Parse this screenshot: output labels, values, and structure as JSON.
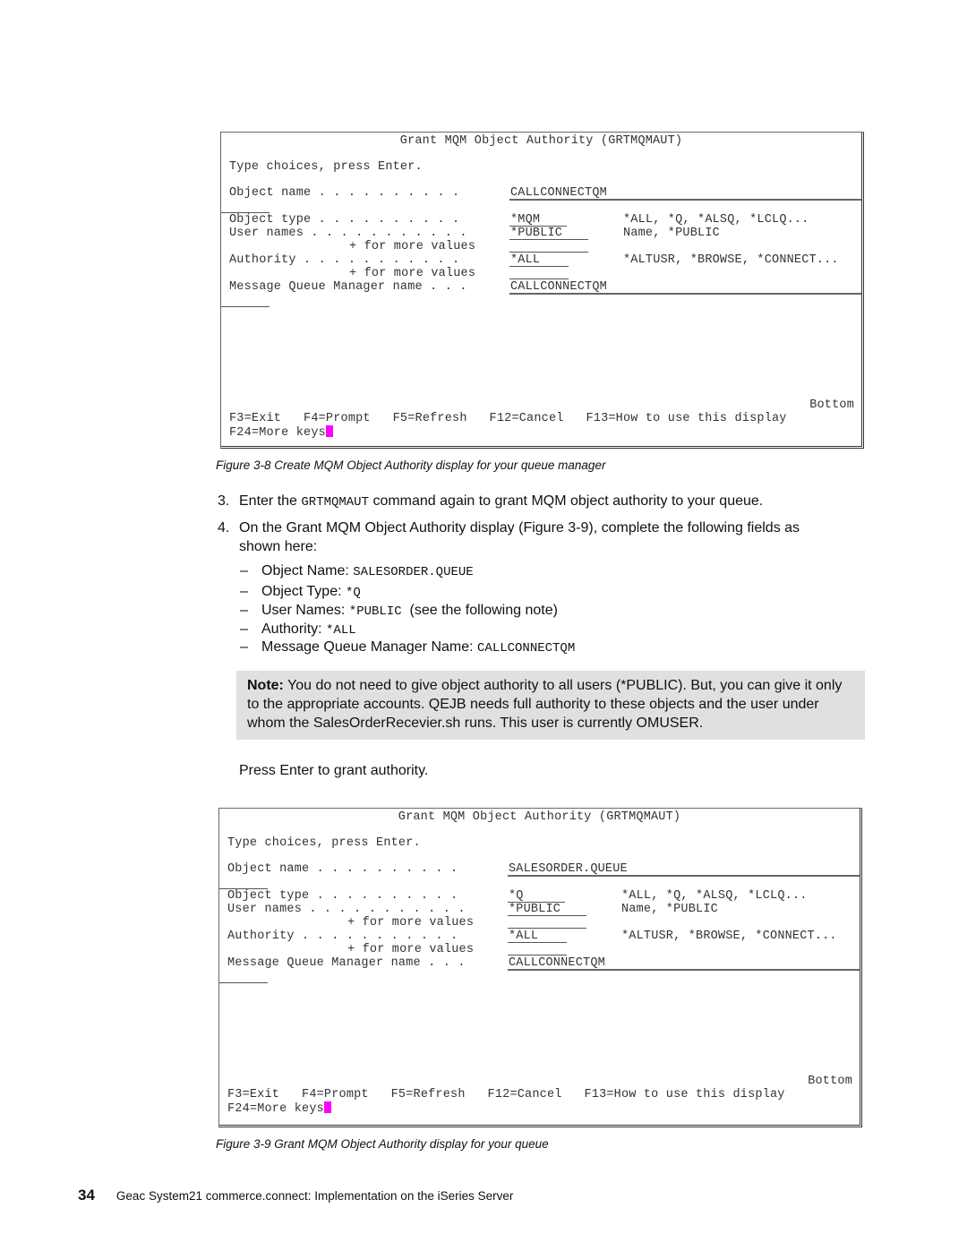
{
  "figure_3_8": {
    "screen": {
      "title": "Grant MQM Object Authority (GRTMQMAUT)",
      "instruction": "Type choices, press Enter.",
      "fields": {
        "object_name": {
          "label": "Object name . . . . . . . . . .",
          "value": "CALLCONNECTQM"
        },
        "object_type": {
          "label": "Object type . . . . . . . . . .",
          "value": "*MQM",
          "hint": "*ALL, *Q, *ALSQ, *LCLQ..."
        },
        "user_names": {
          "label": "User names . . . . . . . . . . .",
          "value": "*PUBLIC",
          "hint": "Name, *PUBLIC",
          "more": "+ for more values"
        },
        "authority": {
          "label": "Authority . . . . . . . . . . .",
          "value": "*ALL",
          "hint": "*ALTUSR, *BROWSE, *CONNECT...",
          "more": "+ for more values"
        },
        "qmgr_name": {
          "label": "Message Queue Manager name . . .",
          "value": "CALLCONNECTQM"
        }
      },
      "status": "Bottom",
      "fkeys_line1": "F3=Exit   F4=Prompt   F5=Refresh   F12=Cancel   F13=How to use this display",
      "fkeys_line2": "F24=More keys"
    },
    "caption": "Figure 3-8   Create MQM Object Authority display for your queue manager"
  },
  "steps": [
    {
      "num": "3.",
      "pre": "Enter the ",
      "code": "GRTMQMAUT",
      "post": " command again to grant MQM object authority to your queue."
    },
    {
      "num": "4.",
      "line1": "On the Grant MQM Object Authority display (Figure 3-9), complete the following fields as",
      "line2": "shown here:"
    }
  ],
  "field_list": [
    {
      "label": "Object Name: ",
      "code": "SALESORDER.QUEUE",
      "suffix": ""
    },
    {
      "label": "Object Type: ",
      "code": "*Q",
      "suffix": ""
    },
    {
      "label": "User Names: ",
      "code": "*PUBLIC",
      "suffix": "  (see the following note)"
    },
    {
      "label": "Authority: ",
      "code": "*ALL",
      "suffix": ""
    },
    {
      "label": "Message Queue Manager Name: ",
      "code": "CALLCONNECTQM",
      "suffix": ""
    }
  ],
  "note": {
    "label": "Note:",
    "text": " You do not need to give object authority to all users (*PUBLIC). But, you can give it only to the appropriate accounts. QEJB needs full authority to these objects and the user under whom the SalesOrderRecevier.sh runs. This user is currently OMUSER."
  },
  "press_enter": "Press Enter to grant authority.",
  "figure_3_9": {
    "screen": {
      "title": "Grant MQM Object Authority (GRTMQMAUT)",
      "instruction": "Type choices, press Enter.",
      "fields": {
        "object_name": {
          "label": "Object name . . . . . . . . . .",
          "value": "SALESORDER.QUEUE"
        },
        "object_type": {
          "label": "Object type . . . . . . . . . .",
          "value": "*Q",
          "hint": "*ALL, *Q, *ALSQ, *LCLQ..."
        },
        "user_names": {
          "label": "User names . . . . . . . . . . .",
          "value": "*PUBLIC",
          "hint": "Name, *PUBLIC",
          "more": "+ for more values"
        },
        "authority": {
          "label": "Authority . . . . . . . . . . .",
          "value": "*ALL",
          "hint": "*ALTUSR, *BROWSE, *CONNECT...",
          "more": "+ for more values"
        },
        "qmgr_name": {
          "label": "Message Queue Manager name . . .",
          "value": "CALLCONNECTQM"
        }
      },
      "status": "Bottom",
      "fkeys_line1": "F3=Exit   F4=Prompt   F5=Refresh   F12=Cancel   F13=How to use this display",
      "fkeys_line2": "F24=More keys"
    },
    "caption": "Figure 3-9   Grant MQM Object Authority display for your queue"
  },
  "footer": {
    "page_number": "34",
    "book_title": "Geac System21 commerce.connect: Implementation on the iSeries Server"
  },
  "colors": {
    "cursor": "#ff00ff",
    "note_background": "#e0e0e0"
  }
}
